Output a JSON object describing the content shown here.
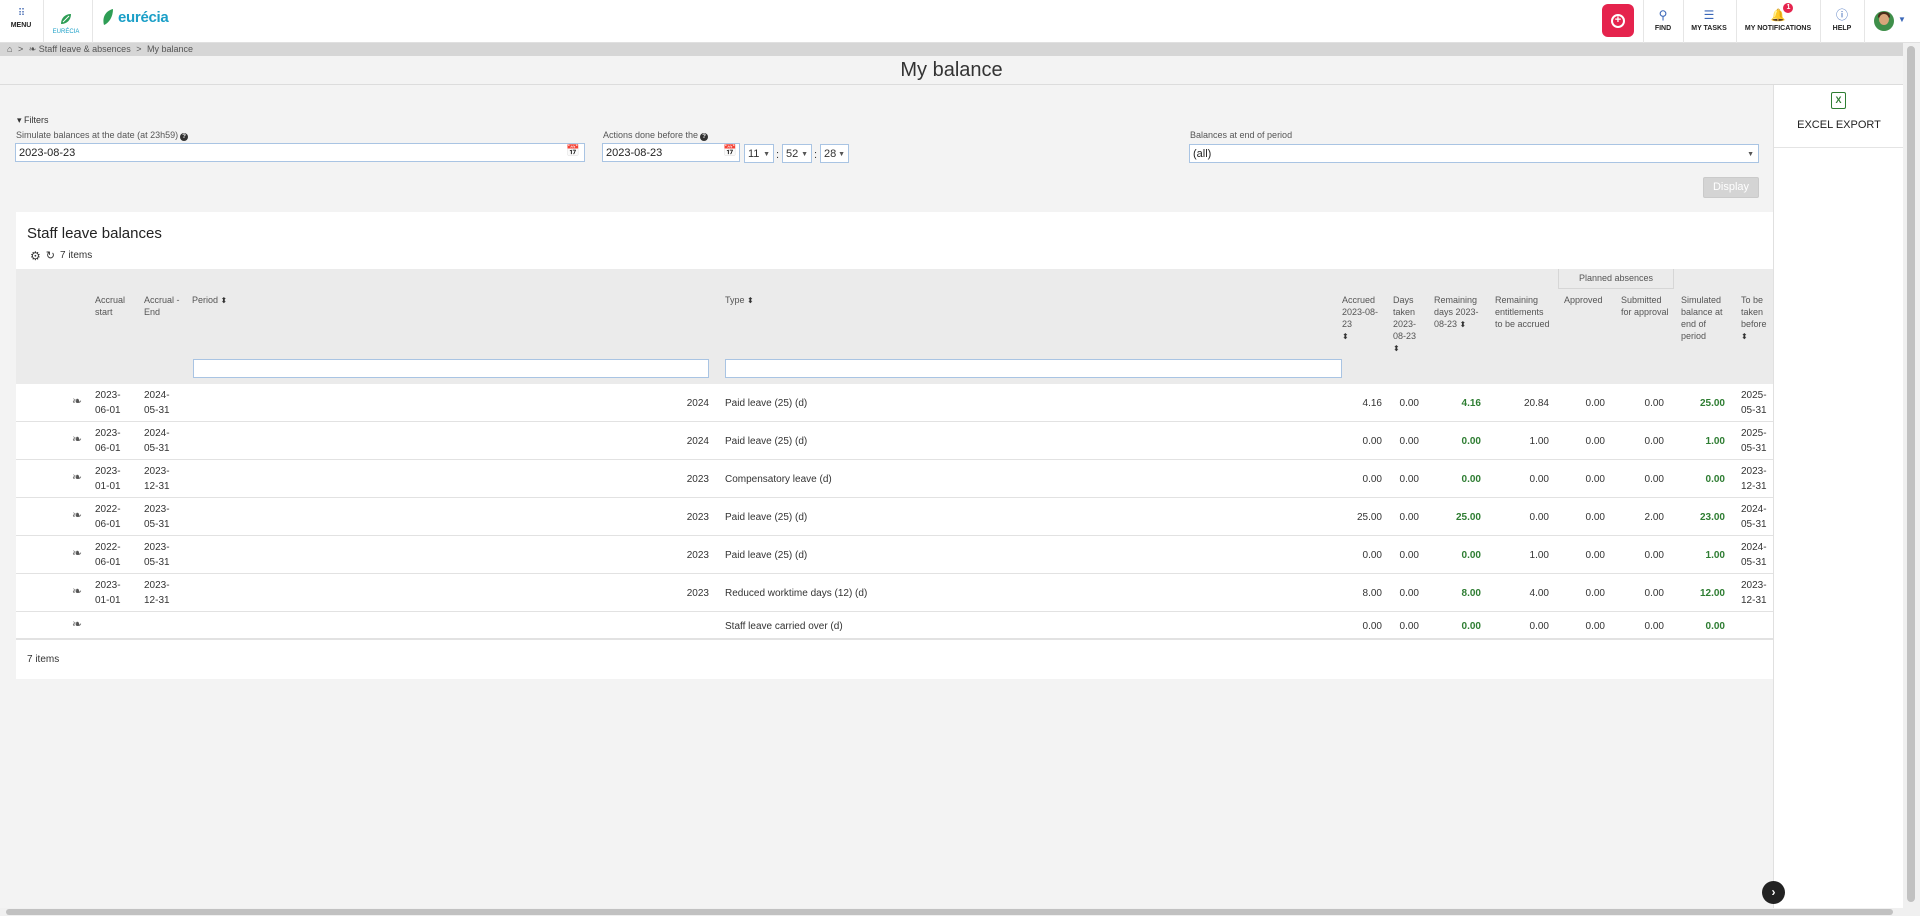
{
  "topbar": {
    "menu_label": "MENU",
    "small_logo_text": "EURÉCIA",
    "brand": "eurécia",
    "find_label": "FIND",
    "tasks_label": "MY TASKS",
    "notifications_label": "MY NOTIFICATIONS",
    "notifications_count": "1",
    "help_label": "HELP"
  },
  "breadcrumb": {
    "home": "⌂",
    "section": "Staff leave & absences",
    "current": "My balance",
    "sep": ">"
  },
  "page_title": "My balance",
  "filters": {
    "toggle_label": "Filters",
    "simulate_label": "Simulate balances at the date (at 23h59)",
    "simulate_value": "2023-08-23",
    "actions_label": "Actions done before the",
    "actions_date": "2023-08-23",
    "hour": "11",
    "minute": "52",
    "second": "28",
    "balances_label": "Balances at end of period",
    "balances_value": "(all)",
    "display_button": "Display"
  },
  "export": {
    "label": "EXCEL EXPORT"
  },
  "table": {
    "title": "Staff leave balances",
    "items_count": "7 items",
    "footer_count": "7 items",
    "headers": {
      "accrual_start": "Accrual start",
      "accrual_end": "Accrual - End",
      "period": "Period",
      "type": "Type",
      "accrued": "Accrued 2023-08-23",
      "days_taken": "Days taken 2023-08-23",
      "remaining_days": "Remaining days 2023-08-23",
      "remaining_entitlements": "Remaining entitlements to be accrued",
      "planned_absences": "Planned absences",
      "approved": "Approved",
      "submitted": "Submitted for approval",
      "simulated": "Simulated balance at end of period",
      "to_be_taken": "To be taken before"
    },
    "rows": [
      {
        "start1": "2023-",
        "start2": "06-01",
        "end1": "2024-",
        "end2": "05-31",
        "period": "2024",
        "type": "Paid leave (25) (d)",
        "accrued": "4.16",
        "taken": "0.00",
        "remaining": "4.16",
        "entitlements": "20.84",
        "approved": "0.00",
        "submitted": "0.00",
        "simulated": "25.00",
        "before1": "2025-",
        "before2": "05-31"
      },
      {
        "start1": "2023-",
        "start2": "06-01",
        "end1": "2024-",
        "end2": "05-31",
        "period": "2024",
        "type": "Paid leave (25) (d)",
        "accrued": "0.00",
        "taken": "0.00",
        "remaining": "0.00",
        "entitlements": "1.00",
        "approved": "0.00",
        "submitted": "0.00",
        "simulated": "1.00",
        "before1": "2025-",
        "before2": "05-31"
      },
      {
        "start1": "2023-",
        "start2": "01-01",
        "end1": "2023-",
        "end2": "12-31",
        "period": "2023",
        "type": "Compensatory leave (d)",
        "accrued": "0.00",
        "taken": "0.00",
        "remaining": "0.00",
        "entitlements": "0.00",
        "approved": "0.00",
        "submitted": "0.00",
        "simulated": "0.00",
        "before1": "2023-",
        "before2": "12-31"
      },
      {
        "start1": "2022-",
        "start2": "06-01",
        "end1": "2023-",
        "end2": "05-31",
        "period": "2023",
        "type": "Paid leave (25) (d)",
        "accrued": "25.00",
        "taken": "0.00",
        "remaining": "25.00",
        "entitlements": "0.00",
        "approved": "0.00",
        "submitted": "2.00",
        "simulated": "23.00",
        "before1": "2024-",
        "before2": "05-31"
      },
      {
        "start1": "2022-",
        "start2": "06-01",
        "end1": "2023-",
        "end2": "05-31",
        "period": "2023",
        "type": "Paid leave (25) (d)",
        "accrued": "0.00",
        "taken": "0.00",
        "remaining": "0.00",
        "entitlements": "1.00",
        "approved": "0.00",
        "submitted": "0.00",
        "simulated": "1.00",
        "before1": "2024-",
        "before2": "05-31"
      },
      {
        "start1": "2023-",
        "start2": "01-01",
        "end1": "2023-",
        "end2": "12-31",
        "period": "2023",
        "type": "Reduced worktime days (12) (d)",
        "accrued": "8.00",
        "taken": "0.00",
        "remaining": "8.00",
        "entitlements": "4.00",
        "approved": "0.00",
        "submitted": "0.00",
        "simulated": "12.00",
        "before1": "2023-",
        "before2": "12-31"
      },
      {
        "start1": "",
        "start2": "",
        "end1": "",
        "end2": "",
        "period": "",
        "type": "Staff leave carried over (d)",
        "accrued": "0.00",
        "taken": "0.00",
        "remaining": "0.00",
        "entitlements": "0.00",
        "approved": "0.00",
        "submitted": "0.00",
        "simulated": "0.00",
        "before1": "",
        "before2": ""
      }
    ]
  },
  "colors": {
    "accent": "#e5234d",
    "brand": "#1b9fc7",
    "positive": "#2e7d32"
  }
}
